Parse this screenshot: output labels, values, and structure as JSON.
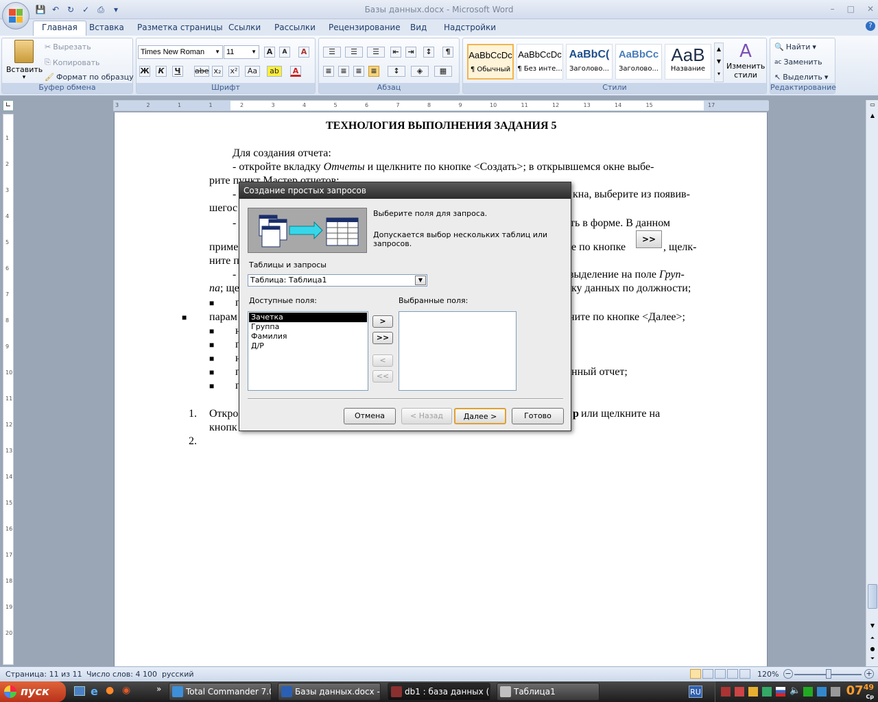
{
  "window": {
    "title": "Базы данных.docx - Microsoft Word",
    "controls": {
      "minimize": "–",
      "maximize": "□",
      "close": "✕"
    },
    "help": "?"
  },
  "qat": [
    "save-icon",
    "undo-icon",
    "redo-icon",
    "spelling-icon",
    "print-icon",
    "customize-icon"
  ],
  "tabs": [
    "Главная",
    "Вставка",
    "Разметка страницы",
    "Ссылки",
    "Рассылки",
    "Рецензирование",
    "Вид",
    "Надстройки"
  ],
  "ribbon": {
    "clipboard": {
      "label": "Буфер обмена",
      "paste": "Вставить",
      "cut": "Вырезать",
      "copy": "Копировать",
      "format_painter": "Формат по образцу"
    },
    "font": {
      "label": "Шрифт",
      "name": "Times New Roman",
      "size": "11",
      "bold": "Ж",
      "italic": "К",
      "underline": "Ч",
      "strike": "abe",
      "sub": "x₂",
      "sup": "x²",
      "case": "Aa",
      "grow": "A",
      "shrink": "A",
      "clear": "A",
      "highlight": "ab",
      "color": "A"
    },
    "paragraph": {
      "label": "Абзац",
      "pilcrow": "¶"
    },
    "styles": {
      "label": "Стили",
      "items": [
        {
          "preview": "AaBbCcDc",
          "name": "¶ Обычный"
        },
        {
          "preview": "AaBbCcDc",
          "name": "¶ Без инте..."
        },
        {
          "preview": "AaBbC(",
          "name": "Заголово..."
        },
        {
          "preview": "AaBbCc",
          "name": "Заголово..."
        },
        {
          "preview": "AaB",
          "name": "Название"
        }
      ],
      "change": "Изменить стили"
    },
    "editing": {
      "label": "Редактирование",
      "find": "Найти",
      "replace": "Заменить",
      "select": "Выделить"
    }
  },
  "ruler": {
    "h_ticks": [
      "3",
      "2",
      "1",
      "1",
      "2",
      "3",
      "4",
      "5",
      "6",
      "7",
      "8",
      "9",
      "10",
      "11",
      "12",
      "13",
      "14",
      "15",
      "17"
    ],
    "v_ticks": [
      "1",
      "2",
      "3",
      "4",
      "5",
      "6",
      "7",
      "8",
      "9",
      "10",
      "11",
      "12",
      "13",
      "14",
      "15",
      "16",
      "17",
      "18",
      "19",
      "20"
    ]
  },
  "document": {
    "heading": "ТЕХНОЛОГИЯ ВЫПОЛНЕНИЯ ЗАДАНИЯ 5",
    "l1": "Для создания отчета:",
    "l2a": "- откройте вкладку ",
    "l2b": "Отчеты",
    "l2c": " и щелкните по кнопке <Создать>; в открывшемся окне выбе-",
    "l3": "рите пункт Мастер отчетов;",
    "l4a": "-",
    "l4b": "кна, выберите из появив-",
    "l5": "шегос",
    "l6a": "-",
    "l6b": "ть в форме. В данном",
    "l7a": "приме",
    "l7b": "е по кнопке",
    "l7btn": ">>",
    "l7c": ", щелк-",
    "l8": "ните п",
    "l9a": "-",
    "l9b": "выделение на поле ",
    "l9c": "Груп-",
    "l10a": "па",
    "l10b": "; ще",
    "l10c": "ку данных по должности;",
    "b1": "п",
    "l11a": "парам",
    "l11b": "ните по кнопке <Далее>;",
    "b3": "н",
    "b4": "п",
    "b5": "н",
    "b6": "п",
    "b6b": "нный отчет;",
    "b7": "п",
    "n1": "1.",
    "n1a": "Откро",
    "n1b": "р",
    "n1c": " или щелкните на",
    "n1d": "кнопк",
    "n2": "2.",
    "bullet": "■"
  },
  "dialog": {
    "title": "Создание простых запросов",
    "info1": "Выберите поля для запроса.",
    "info2": "Допускается выбор нескольких таблиц или запросов.",
    "tables_label": "Таблицы и запросы",
    "table_value": "Таблица: Таблица1",
    "available_label": "Доступные поля:",
    "selected_label": "Выбранные поля:",
    "fields": [
      "Зачетка",
      "Группа",
      "Фамилия",
      "Д/Р"
    ],
    "move_one": ">",
    "move_all": ">>",
    "remove_one": "<",
    "remove_all": "<<",
    "cancel": "Отмена",
    "back": "< Назад",
    "next": "Далее >",
    "finish": "Готово"
  },
  "status": {
    "page": "Страница: 11 из 11",
    "words": "Число слов: 4 100",
    "lang": "русский",
    "zoom": "120%"
  },
  "taskbar": {
    "start": "пуск",
    "more": "»",
    "buttons": [
      "Total Commander 7.0....",
      "Базы данных.docx - ...",
      "db1 : база данных (...",
      "Таблица1"
    ],
    "lang": "RU",
    "time": "07",
    "time_min": "49",
    "day": "Ср"
  }
}
